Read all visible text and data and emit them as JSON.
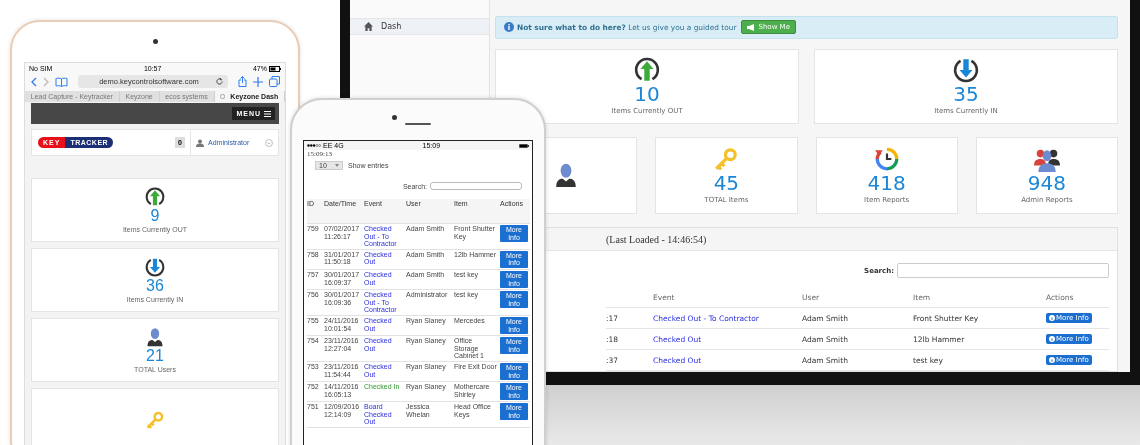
{
  "monitor": {
    "sidebar": {
      "items": [
        {
          "label": "Dash",
          "selected": true
        }
      ]
    },
    "alert": {
      "text": "**Not sure what to do here?** Let us give you a guided tour",
      "button": "Show Me"
    },
    "stats_top": [
      {
        "kind": "out",
        "value": "10",
        "label": "Items Currently OUT"
      },
      {
        "kind": "in",
        "value": "35",
        "label": "Items Currently IN"
      }
    ],
    "stats_bottom": [
      {
        "kind": "users"
      },
      {
        "kind": "key",
        "value": "45",
        "label": "TOTAL Items"
      },
      {
        "kind": "reports",
        "value": "418",
        "label": "Item Reports"
      },
      {
        "kind": "admins",
        "value": "948",
        "label": "Admin Reports"
      }
    ],
    "log": {
      "title": "(Last Loaded - 14:46:54)",
      "search_label": "Search:",
      "columns": [
        "Event",
        "User",
        "Item",
        "Actions"
      ],
      "rows": [
        {
          "column_1": ":17",
          "event": "Checked Out - To Contractor",
          "kind": "out",
          "user": "Adam Smith",
          "item": "Front Shutter Key",
          "action": "More Info"
        },
        {
          "column_1": ":18",
          "event": "Checked Out",
          "kind": "out",
          "user": "Adam Smith",
          "item": "12lb Hammer",
          "action": "More Info"
        },
        {
          "column_1": ":37",
          "event": "Checked Out",
          "kind": "out",
          "user": "Adam Smith",
          "item": "test key",
          "action": "More Info"
        }
      ]
    }
  },
  "tablet": {
    "status": {
      "carrier": "No SIM",
      "time": "10:57",
      "battery": "47%"
    },
    "url": "demo.keycontrolsoftware.com",
    "tabs": [
      {
        "label": "Lead Capture - Keytracker",
        "selected": false
      },
      {
        "label": "Keyzone",
        "selected": false
      },
      {
        "label": "ecos systems",
        "selected": false
      },
      {
        "label": "Keyzone Dash",
        "selected": true
      }
    ],
    "menu_button": "MENU",
    "logo": {
      "left": "KEY",
      "right": "TRACKER"
    },
    "badge": "0",
    "user": "Administrator",
    "stats": [
      {
        "kind": "out",
        "value": "9",
        "label": "Items Currently OUT"
      },
      {
        "kind": "in",
        "value": "36",
        "label": "Items Currently IN"
      },
      {
        "kind": "users",
        "value": "21",
        "label": "TOTAL Users"
      },
      {
        "kind": "key"
      }
    ]
  },
  "phone": {
    "status": {
      "carrier": "EE  4G",
      "time": "15:09"
    },
    "loaded": "15:09:13",
    "page_size": "10",
    "show_entries": "Show  entries",
    "search_label": "Search:",
    "columns": [
      "ID",
      "Date/Time",
      "Event",
      "User",
      "Item",
      "Actions"
    ],
    "rows": [
      {
        "id": "759",
        "date": "07/02/2017",
        "time": "11:26:17",
        "event": "Checked Out - To Contractor",
        "kind": "out",
        "user": "Adam Smith",
        "item": "Front Shutter Key",
        "action": "More Info"
      },
      {
        "id": "758",
        "date": "31/01/2017",
        "time": "11:50:18",
        "event": "Checked Out",
        "kind": "out",
        "user": "Adam Smith",
        "item": "12lb Hammer",
        "action": "More Info"
      },
      {
        "id": "757",
        "date": "30/01/2017",
        "time": "16:09:37",
        "event": "Checked Out",
        "kind": "out",
        "user": "Adam Smith",
        "item": "test key",
        "action": "More Info"
      },
      {
        "id": "756",
        "date": "30/01/2017",
        "time": "16:09:36",
        "event": "Checked Out - To Contractor",
        "kind": "out",
        "user": "Administrator",
        "item": "test key",
        "action": "More Info"
      },
      {
        "id": "755",
        "date": "24/11/2016",
        "time": "10:01:54",
        "event": "Checked Out",
        "kind": "out",
        "user": "Ryan Slaney",
        "item": "Mercedes",
        "action": "More Info"
      },
      {
        "id": "754",
        "date": "23/11/2016",
        "time": "12:27:04",
        "event": "Checked Out",
        "kind": "out",
        "user": "Ryan Slaney",
        "item": "Office Storage Cabinet 1",
        "action": "More Info"
      },
      {
        "id": "753",
        "date": "23/11/2016",
        "time": "11:54:44",
        "event": "Checked Out",
        "kind": "out",
        "user": "Ryan Slaney",
        "item": "Fire Exit Door",
        "action": "More Info"
      },
      {
        "id": "752",
        "date": "14/11/2016",
        "time": "16:05:13",
        "event": "Checked In",
        "kind": "in",
        "user": "Ryan Slaney",
        "item": "Mothercare Shirley",
        "action": "More Info"
      },
      {
        "id": "751",
        "date": "12/09/2016",
        "time": "12:14:09",
        "event": "Board Checked Out",
        "kind": "out",
        "user": "Jessica Whelan",
        "item": "Head Office Keys",
        "action": "More Info"
      }
    ]
  }
}
